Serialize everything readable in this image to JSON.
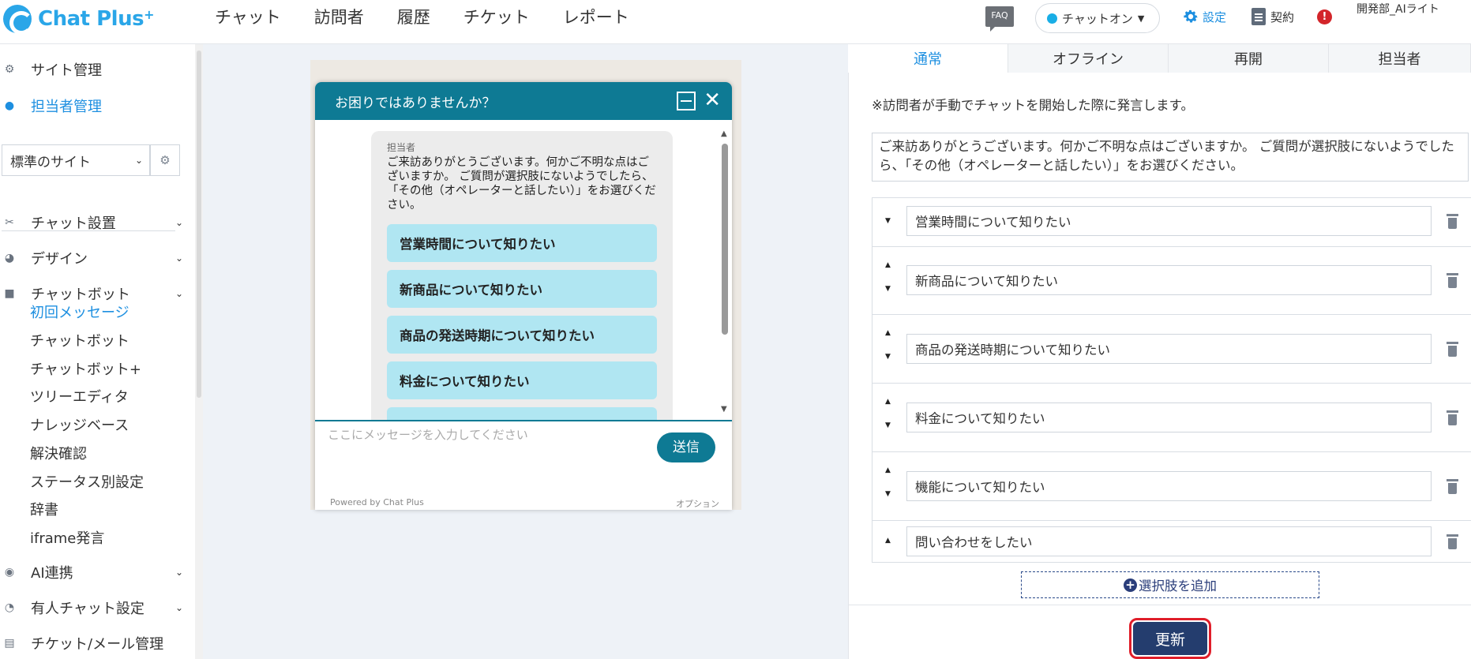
{
  "brand": {
    "name": "Chat Plus",
    "plus": "+"
  },
  "nav": [
    "チャット",
    "訪問者",
    "履歴",
    "チケット",
    "レポート"
  ],
  "header": {
    "faq": "FAQ",
    "chat_status": "チャットオン",
    "settings": "設定",
    "contract": "契約",
    "alert": "!",
    "user": "開発部_AIライト"
  },
  "sidebar": {
    "top_items": [
      {
        "label": "サイト管理",
        "icon": "gear-small-icon"
      },
      {
        "label": "担当者管理",
        "icon": "users-icon"
      }
    ],
    "site_select": "標準のサイト",
    "sections": [
      {
        "label": "チャット設置",
        "icon": "tools-icon"
      },
      {
        "label": "デザイン",
        "icon": "palette-icon"
      },
      {
        "label": "チャットボット",
        "icon": "chat-icon"
      },
      {
        "label": "AI連携",
        "icon": "ai-icon"
      },
      {
        "label": "有人チャット設定",
        "icon": "operator-icon"
      },
      {
        "label": "チケット/メール管理",
        "icon": "ticket-icon"
      }
    ],
    "chatbot_sub": [
      "初回メッセージ",
      "チャットボット",
      "チャットボット+",
      "ツリーエディタ",
      "ナレッジベース",
      "解決確認",
      "ステータス別設定",
      "辞書",
      "iframe発言"
    ]
  },
  "widget": {
    "title": "お困りではありませんか？",
    "author": "担当者",
    "message": "ご来訪ありがとうございます。何かご不明な点はございますか。 ご質問が選択肢にないようでしたら、「その他（オペレーターと話したい）」をお選びください。",
    "options": [
      "営業時間について知りたい",
      "新商品について知りたい",
      "商品の発送時期について知りたい",
      "料金について知りたい"
    ],
    "placeholder": "ここにメッセージを入力してください",
    "send": "送信",
    "powered": "Powered by Chat Plus",
    "option_link": "オプション"
  },
  "panel": {
    "tabs": [
      "通常",
      "オフライン",
      "再開",
      "担当者"
    ],
    "note": "※訪問者が手動でチャットを開始した際に発言します。",
    "message": "ご来訪ありがとうございます。何かご不明な点はございますか。 ご質問が選択肢にないようでしたら、「その他（オペレーターと話したい）」をお選びください。",
    "choices": [
      "営業時間について知りたい",
      "新商品について知りたい",
      "商品の発送時期について知りたい",
      "料金について知りたい",
      "機能について知りたい",
      "問い合わせをしたい"
    ],
    "add_choice": "選択肢を追加",
    "update": "更新"
  }
}
